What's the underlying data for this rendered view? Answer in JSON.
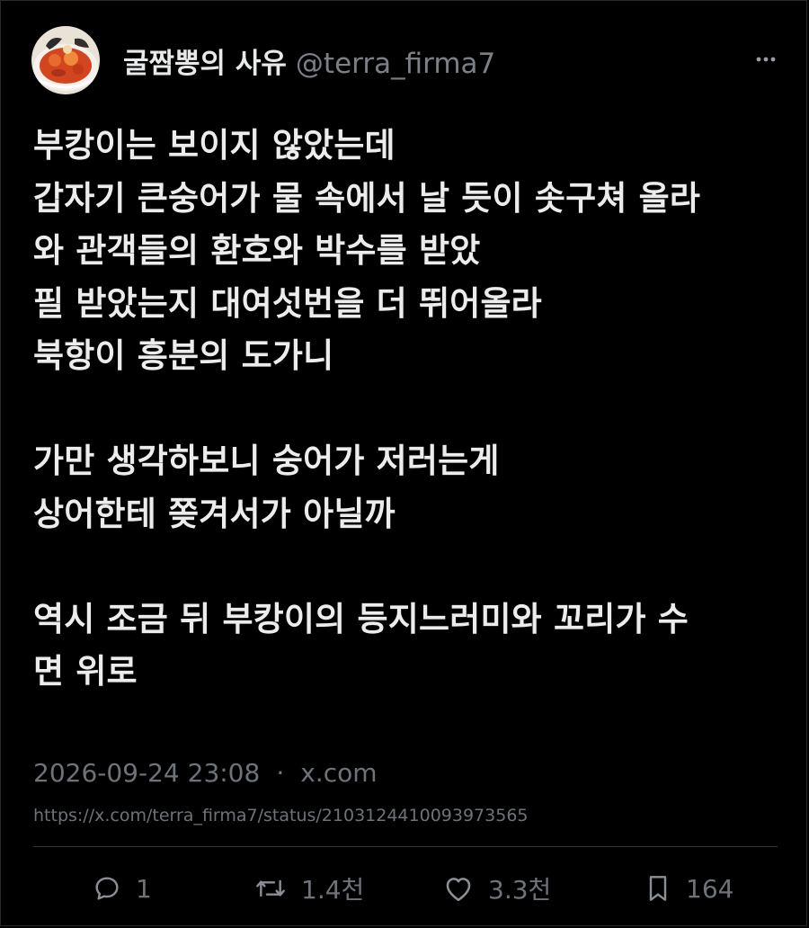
{
  "author": {
    "display_name": "굴짬뽕의 사유",
    "handle": "@terra_firma7",
    "avatar": "food-bowl-avatar"
  },
  "tweet": {
    "lines": [
      "부캉이는 보이지 않았는데",
      "갑자기 큰숭어가 물 속에서 날 듯이 솟구쳐 올라",
      "와 관객들의 환호와 박수를 받았",
      "필 받았는지 대여섯번을 더 뛰어올라",
      "북항이 흥분의 도가니",
      "",
      "가만 생각하보니 숭어가 저러는게",
      "상어한테 쫒겨서가 아닐까",
      "",
      "역시 조금 뒤 부캉이의 등지느러미와 꼬리가 수",
      "면 위로"
    ]
  },
  "meta": {
    "timestamp": "2026-09-24 23:08",
    "separator": "·",
    "source": "x.com",
    "url": "https://x.com/terra_firma7/status/2103124410093973565"
  },
  "actions": {
    "reply": {
      "icon": "reply-icon",
      "count": "1"
    },
    "repost": {
      "icon": "repost-icon",
      "count": "1.4천"
    },
    "like": {
      "icon": "heart-icon",
      "count": "3.3천"
    },
    "bookmark": {
      "icon": "bookmark-icon",
      "count": "164"
    }
  },
  "colors": {
    "background": "#000000",
    "text": "#e7e9ea",
    "muted": "#6e737a",
    "divider": "#2f3336"
  }
}
